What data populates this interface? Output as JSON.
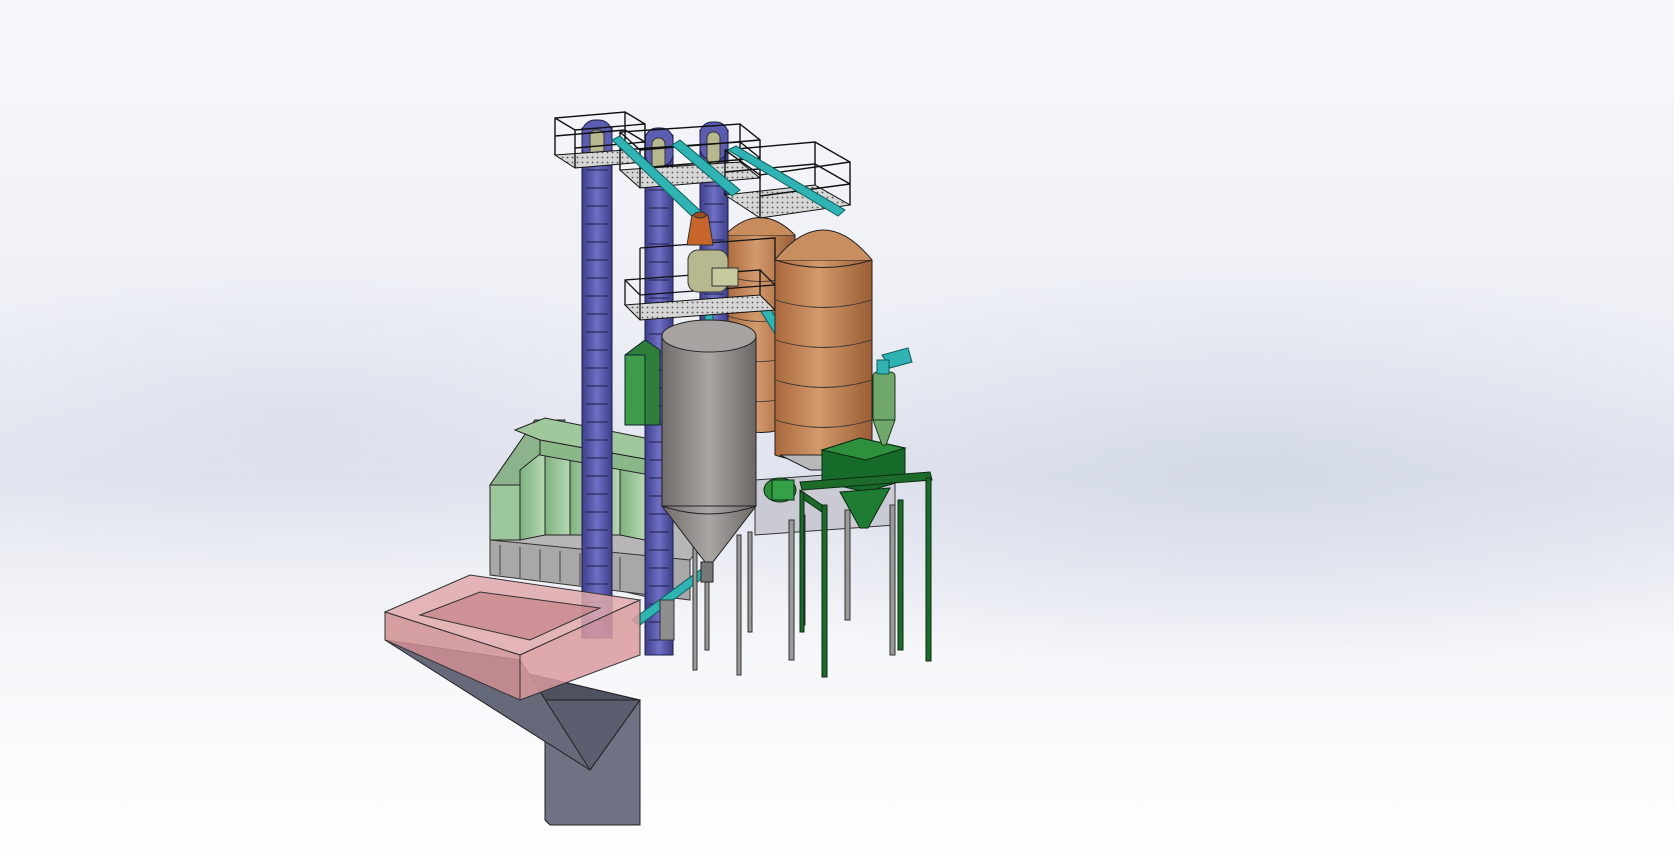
{
  "view": {
    "background_top": "#f7f8fb",
    "background_band": "#e4e7f0",
    "background_bottom": "#ffffff"
  },
  "plant": {
    "elevator_color": "#5c5cb0",
    "elevator_dark": "#3a3a7a",
    "conveyor_color": "#2fb3b3",
    "silo_copper": "#c08658",
    "silo_grey": "#8a8784",
    "hopper_pink": "#d99a9e",
    "hopper_grey": "#5b5e6e",
    "cleaner_green": "#9cc79c",
    "frame_green": "#1c6b2a",
    "cyclone_green": "#6fa86a",
    "frame_grey": "#8e8e8e",
    "platform_grating": "#c8c8c8",
    "motor_khaki": "#b8b890",
    "cone_orange": "#c8652a"
  }
}
